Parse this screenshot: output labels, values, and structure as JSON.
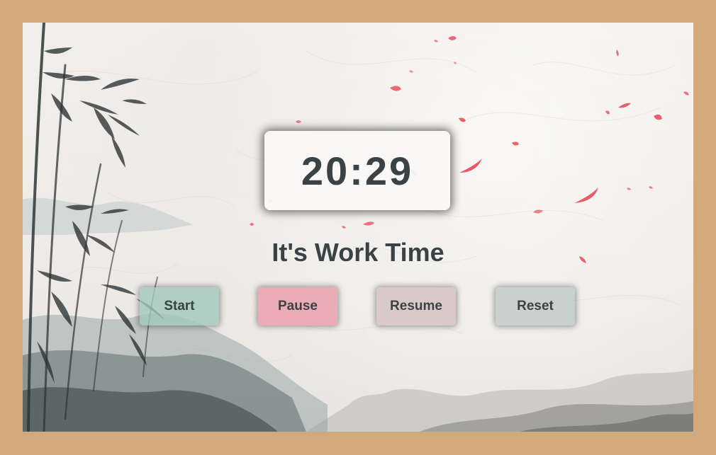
{
  "timer": {
    "display": "20:29"
  },
  "status": {
    "label": "It's Work Time"
  },
  "controls": {
    "start_label": "Start",
    "pause_label": "Pause",
    "resume_label": "Resume",
    "reset_label": "Reset"
  },
  "colors": {
    "frame_border": "#d2a97c",
    "text": "#3b4246",
    "start_button": "#a0c6ba",
    "pause_button": "#e9a0ac",
    "resume_button": "#d6c2c3",
    "reset_button": "#c4cdcb",
    "petal": "#e8505e"
  },
  "decor": {
    "background_motif": "ink-wash-bamboo-and-mountains",
    "petals": "red-petals"
  }
}
